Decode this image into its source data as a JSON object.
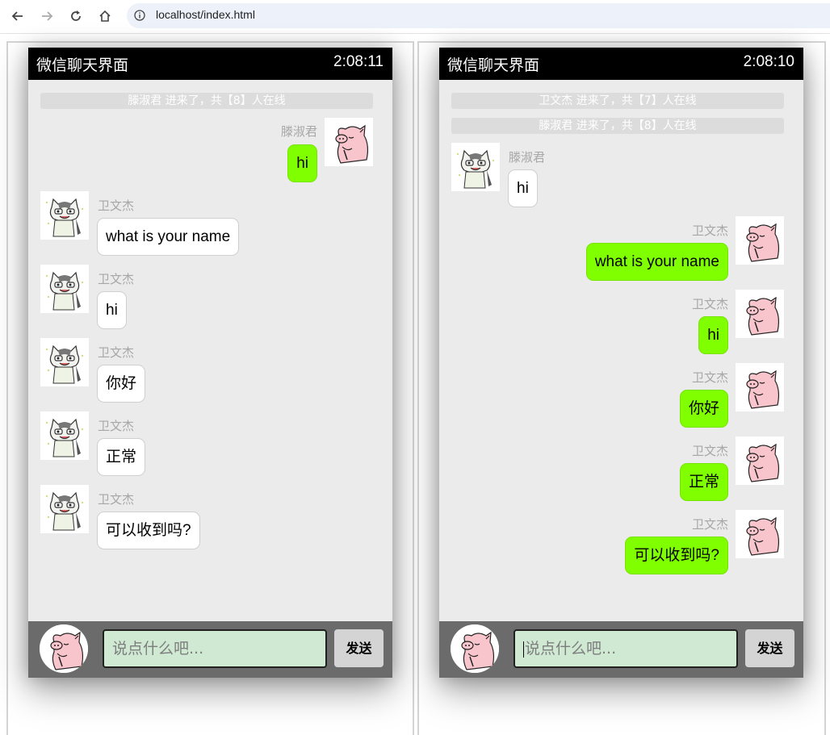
{
  "browser": {
    "url": "localhost/index.html"
  },
  "left_window": {
    "title": "微信聊天界面",
    "time": "2:08:11",
    "notices": [
      "滕淑君 进来了，共【8】人在线"
    ],
    "messages": [
      {
        "sender": "滕淑君",
        "text": "hi",
        "side": "right",
        "avatar": "pig-avatar"
      },
      {
        "sender": "卫文杰",
        "text": "what is your name",
        "side": "left",
        "avatar": "cat-avatar"
      },
      {
        "sender": "卫文杰",
        "text": "hi",
        "side": "left",
        "avatar": "cat-avatar"
      },
      {
        "sender": "卫文杰",
        "text": "你好",
        "side": "left",
        "avatar": "cat-avatar"
      },
      {
        "sender": "卫文杰",
        "text": "正常",
        "side": "left",
        "avatar": "cat-avatar"
      },
      {
        "sender": "卫文杰",
        "text": "可以收到吗?",
        "side": "left",
        "avatar": "cat-avatar"
      }
    ],
    "input_placeholder": "说点什么吧...",
    "send_label": "发送"
  },
  "right_window": {
    "title": "微信聊天界面",
    "time": "2:08:10",
    "notices": [
      "卫文杰 进来了，共【7】人在线",
      "滕淑君 进来了，共【8】人在线"
    ],
    "messages": [
      {
        "sender": "滕淑君",
        "text": "hi",
        "side": "left",
        "avatar": "cat-avatar"
      },
      {
        "sender": "卫文杰",
        "text": "what is your name",
        "side": "right",
        "avatar": "pig-avatar"
      },
      {
        "sender": "卫文杰",
        "text": "hi",
        "side": "right",
        "avatar": "pig-avatar"
      },
      {
        "sender": "卫文杰",
        "text": "你好",
        "side": "right",
        "avatar": "pig-avatar"
      },
      {
        "sender": "卫文杰",
        "text": "正常",
        "side": "right",
        "avatar": "pig-avatar"
      },
      {
        "sender": "卫文杰",
        "text": "可以收到吗?",
        "side": "right",
        "avatar": "pig-avatar"
      }
    ],
    "input_placeholder": "说点什么吧...",
    "send_label": "发送"
  },
  "colors": {
    "own_bubble": "#80ff00",
    "other_bubble": "#ffffff",
    "title_bar": "#000000",
    "chat_bg": "#ebebeb",
    "bottom_bar": "#6b6b6b"
  }
}
